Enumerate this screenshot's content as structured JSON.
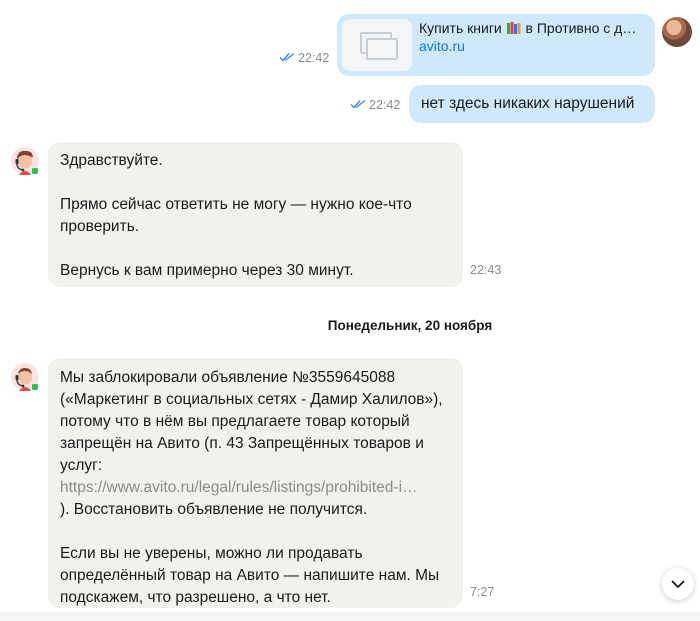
{
  "messages": {
    "link": {
      "title": "Купить книги 📚 в Противно с доставкой",
      "title_before": "Купить книги",
      "title_after": "в Противно с до…",
      "domain": "avito.ru",
      "time": "22:42"
    },
    "out_text": {
      "text": "нет здесь никаких нарушений",
      "time": "22:42"
    },
    "incoming_1": {
      "lines": [
        "Здравствуйте.",
        "Прямо сейчас ответить не могу — нужно кое-что проверить.",
        "Вернусь к вам примерно через 30 минут."
      ],
      "time": "22:43"
    },
    "date_separator": "Понедельник, 20 ноября",
    "incoming_2": {
      "text_before_link": "Мы заблокировали объявление №3559645088 («Маркетинг в социальных сетях - Дамир Халилов»), потому что в нём вы предлагаете товар который запрещён на Авито (п. 43 Запрещённых товаров и услуг:",
      "link": "https://www.avito.ru/legal/rules/listings/prohibited-i…",
      "text_after_link": "). Восстановить объявление не получится.",
      "paragraph_2": "Если вы не уверены, можно ли продавать определённый товар на Авито — напишите нам. Мы подскажем, что разрешено, а что нет.",
      "time": "7:27"
    }
  },
  "colors": {
    "outgoing_bubble": "#cfe8fb",
    "incoming_bubble": "#f2f1ee",
    "link": "#0a7bd6",
    "read_check": "#3d8bd9"
  },
  "icons": [
    "double-check-icon",
    "image-placeholder-icon",
    "books-emoji-icon",
    "support-agent-icon",
    "chevron-down-icon"
  ]
}
